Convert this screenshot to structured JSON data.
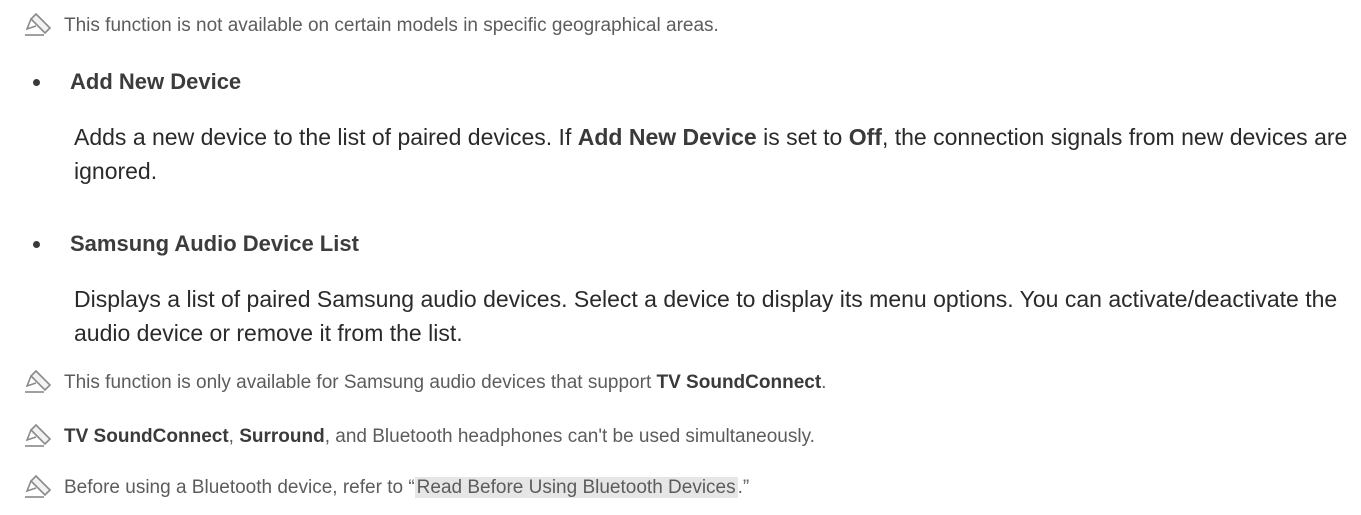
{
  "notes": {
    "n1": "This function is not available on certain models in specific geographical areas.",
    "n2": {
      "pre": "This function is only available for Samsung audio devices that support ",
      "bold": "TV SoundConnect",
      "post": "."
    },
    "n3": {
      "bold1": "TV SoundConnect",
      "mid1": ", ",
      "bold2": "Surround",
      "post": ", and Bluetooth headphones can't be used simultaneously."
    },
    "n4": {
      "pre": "Before using a Bluetooth device, refer to “",
      "link": "Read Before Using Bluetooth Devices",
      "post": ".”"
    }
  },
  "items": {
    "add": {
      "title": "Add New Device",
      "desc_pre": "Adds a new device to the list of paired devices. If ",
      "desc_bold1": "Add New Device",
      "desc_mid": " is set to ",
      "desc_bold2": "Off",
      "desc_post": ", the connection signals from new devices are ignored."
    },
    "list": {
      "title": "Samsung Audio Device List",
      "desc": "Displays a list of paired Samsung audio devices. Select a device to display its menu options. You can activate/deactivate the audio device or remove it from the list."
    }
  },
  "icons": {
    "note": "pencil-icon"
  }
}
